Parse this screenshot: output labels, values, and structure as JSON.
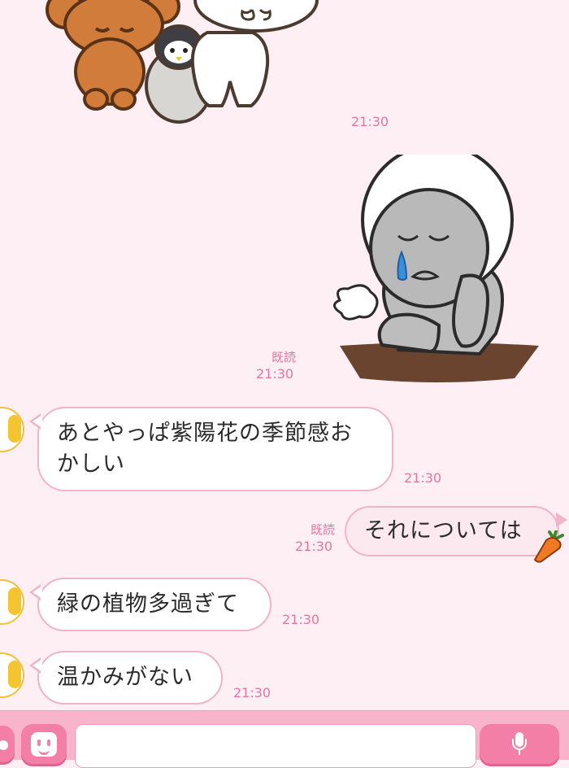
{
  "stickers": [
    {
      "name": "poodle-penguin-bear-sticker",
      "time": "21:30"
    },
    {
      "name": "crying-moon-sticker",
      "read": "既読",
      "time": "21:30"
    }
  ],
  "messages": [
    {
      "side": "in",
      "text_line1": "あとやっぱ紫陽花の季節感お",
      "text_line2": "かしい",
      "time": "21:30"
    },
    {
      "side": "out",
      "text": "それについては",
      "read": "既読",
      "time": "21:30",
      "emoji": "carrot"
    },
    {
      "side": "in",
      "text": "緑の植物多過ぎて",
      "time": "21:30"
    },
    {
      "side": "in",
      "text": "温かみがない",
      "time": "21:30"
    }
  ],
  "input_bar": {
    "placeholder": "",
    "icons": [
      "plus-icon",
      "sticker-face-icon",
      "microphone-icon"
    ]
  },
  "colors": {
    "background": "#fdeff4",
    "bubble_border": "#f1b3c9",
    "timestamp": "#e0789e",
    "bar": "#f7b4cb",
    "button": "#f37fa6"
  }
}
